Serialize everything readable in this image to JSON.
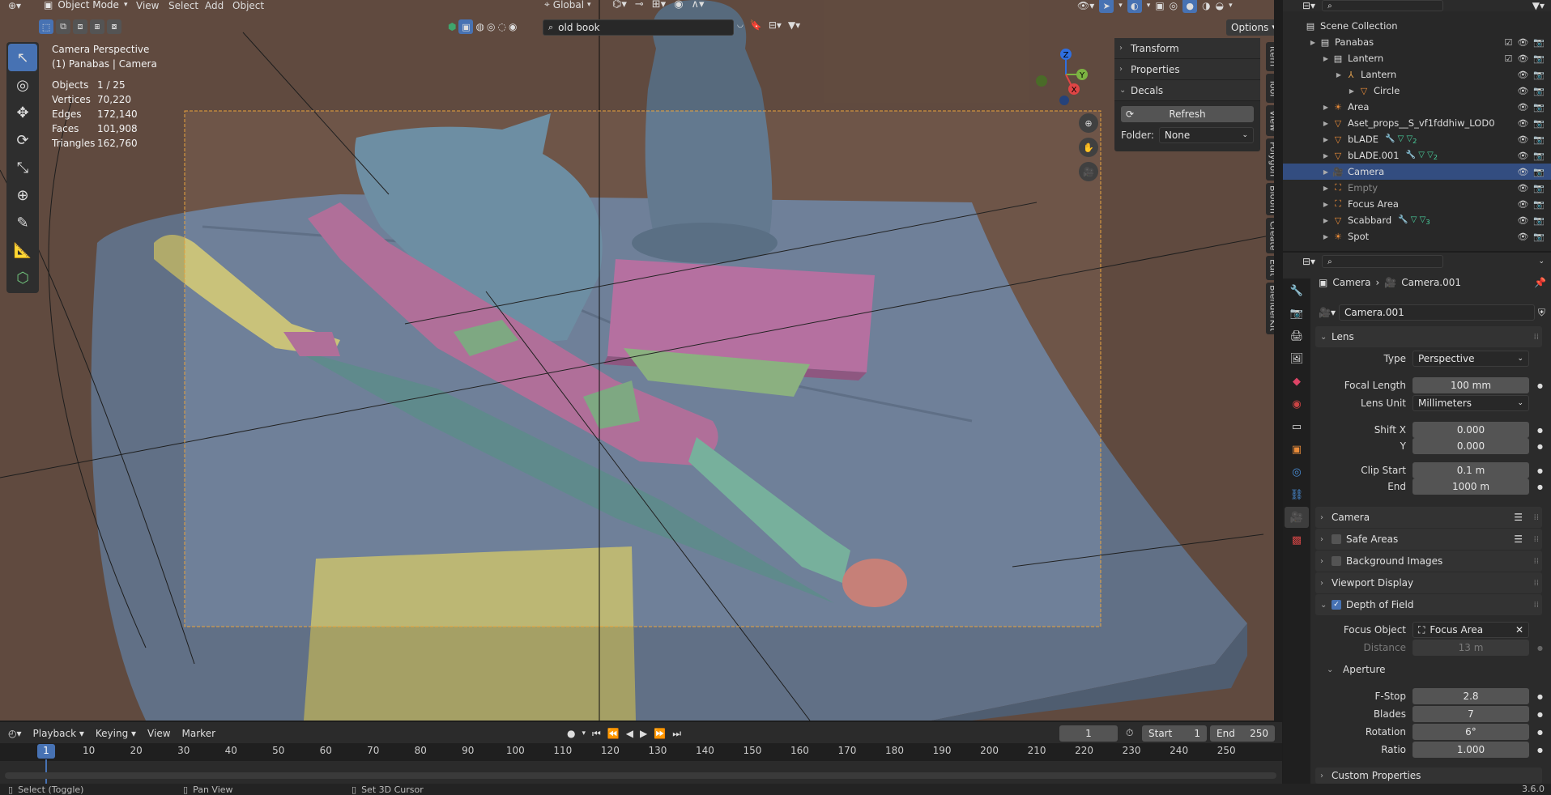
{
  "viewport": {
    "header": {
      "mode": "Object Mode",
      "menus": [
        "View",
        "Select",
        "Add",
        "Object"
      ],
      "transform_orientation": "Global",
      "search_value": "old book",
      "options_label": "Options"
    },
    "overlay_title": "Camera Perspective",
    "overlay_subtitle": "(1) Panabas | Camera",
    "stats": [
      {
        "label": "Objects",
        "value": "1 / 25"
      },
      {
        "label": "Vertices",
        "value": "70,220"
      },
      {
        "label": "Edges",
        "value": "172,140"
      },
      {
        "label": "Faces",
        "value": "101,908"
      },
      {
        "label": "Triangles",
        "value": "162,760"
      }
    ],
    "gizmo": {
      "z": "Z",
      "y": "Y",
      "x": "X"
    },
    "side_tabs": [
      "Item",
      "Tool",
      "View",
      "Polygon",
      "Bloom",
      "Create",
      "Edit",
      "BlenderKit"
    ],
    "npanel": {
      "transform": "Transform",
      "properties": "Properties",
      "decals": "Decals",
      "refresh": "Refresh",
      "folder_label": "Folder:",
      "folder_value": "None"
    }
  },
  "outliner": {
    "root": "Scene Collection",
    "rows": [
      {
        "label": "Panabas",
        "indent": 1,
        "icon": "collection-icon"
      },
      {
        "label": "Lantern",
        "indent": 2,
        "icon": "collection-icon"
      },
      {
        "label": "Lantern",
        "indent": 3,
        "icon": "armature-icon"
      },
      {
        "label": "Circle",
        "indent": 4,
        "icon": "mesh-icon"
      },
      {
        "label": "Area",
        "indent": 2,
        "icon": "light-icon"
      },
      {
        "label": "Aset_props__S_vf1fddhiw_LOD0",
        "indent": 2,
        "icon": "mesh-icon"
      },
      {
        "label": "bLADE",
        "indent": 2,
        "icon": "mesh-icon",
        "badge": "2"
      },
      {
        "label": "bLADE.001",
        "indent": 2,
        "icon": "mesh-icon",
        "badge": "2"
      },
      {
        "label": "Camera",
        "indent": 2,
        "icon": "camera-icon",
        "selected": true
      },
      {
        "label": "Empty",
        "indent": 2,
        "icon": "empty-icon",
        "dim": true
      },
      {
        "label": "Focus Area",
        "indent": 2,
        "icon": "empty-icon"
      },
      {
        "label": "Scabbard",
        "indent": 2,
        "icon": "mesh-icon",
        "badge": "3"
      },
      {
        "label": "Spot",
        "indent": 2,
        "icon": "light-icon"
      }
    ]
  },
  "properties": {
    "breadcrumb_obj": "Camera",
    "breadcrumb_data": "Camera.001",
    "datablock": "Camera.001",
    "lens": {
      "title": "Lens",
      "type_label": "Type",
      "type_value": "Perspective",
      "focal_label": "Focal Length",
      "focal_value": "100 mm",
      "unit_label": "Lens Unit",
      "unit_value": "Millimeters",
      "shiftx_label": "Shift X",
      "shiftx_value": "0.000",
      "shifty_label": "Y",
      "shifty_value": "0.000",
      "clipstart_label": "Clip Start",
      "clipstart_value": "0.1 m",
      "clipend_label": "End",
      "clipend_value": "1000 m"
    },
    "camera": "Camera",
    "safe_areas": "Safe Areas",
    "background_images": "Background Images",
    "viewport_display": "Viewport Display",
    "dof": {
      "title": "Depth of Field",
      "focus_label": "Focus Object",
      "focus_value": "Focus Area",
      "distance_label": "Distance",
      "distance_value": "13 m",
      "aperture": "Aperture",
      "fstop_label": "F-Stop",
      "fstop_value": "2.8",
      "blades_label": "Blades",
      "blades_value": "7",
      "rotation_label": "Rotation",
      "rotation_value": "6°",
      "ratio_label": "Ratio",
      "ratio_value": "1.000"
    },
    "custom_properties": "Custom Properties"
  },
  "timeline": {
    "menus": [
      "Playback",
      "Keying",
      "View",
      "Marker"
    ],
    "current_frame": "1",
    "start_label": "Start",
    "start_value": "1",
    "end_label": "End",
    "end_value": "250",
    "ticks": [
      "1",
      "10",
      "20",
      "30",
      "40",
      "50",
      "60",
      "70",
      "80",
      "90",
      "100",
      "110",
      "120",
      "130",
      "140",
      "150",
      "160",
      "170",
      "180",
      "190",
      "200",
      "210",
      "220",
      "230",
      "240",
      "250"
    ]
  },
  "status": {
    "select": "Select (Toggle)",
    "pan": "Pan View",
    "cursor": "Set 3D Cursor",
    "version": "3.6.0"
  },
  "colors": {
    "accent": "#4772b3",
    "selection": "#334d80",
    "viewport_bg": "#6e5548",
    "camera_frame": "#e8a23c"
  }
}
